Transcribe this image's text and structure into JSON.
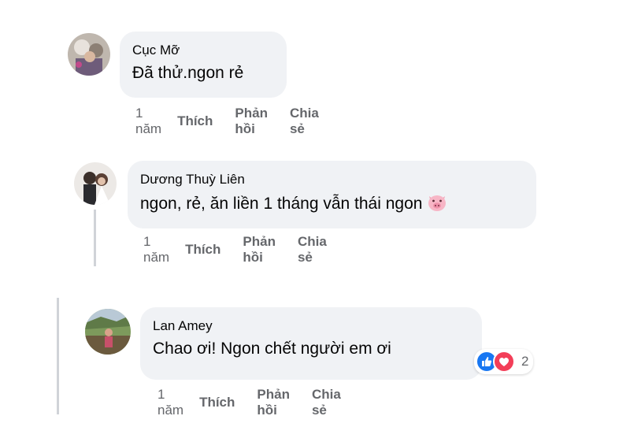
{
  "comments": [
    {
      "author": "Cục Mỡ",
      "text": "Đã thử.ngon rẻ",
      "time": "1 năm",
      "like_label": "Thích",
      "reply_label": "Phản hồi",
      "share_label": "Chia sẻ"
    },
    {
      "author": "Dương Thuỳ Liên",
      "text": "ngon, rẻ, ăn liền 1 tháng vẫn thái ngon",
      "emoji": "pig-face-icon",
      "time": "1 năm",
      "like_label": "Thích",
      "reply_label": "Phản hồi",
      "share_label": "Chia sẻ"
    },
    {
      "author": "Lan Amey",
      "text": "Chao ơi! Ngon chết người em ơi",
      "time": "1 năm",
      "like_label": "Thích",
      "reply_label": "Phản hồi",
      "share_label": "Chia sẻ",
      "reactions": {
        "icons": [
          "like-icon",
          "love-icon"
        ],
        "count": "2"
      }
    }
  ],
  "colors": {
    "bubble": "#f0f2f5",
    "meta_text": "#65676b",
    "like_blue": "#1877f2",
    "love_red": "#f33e58"
  }
}
